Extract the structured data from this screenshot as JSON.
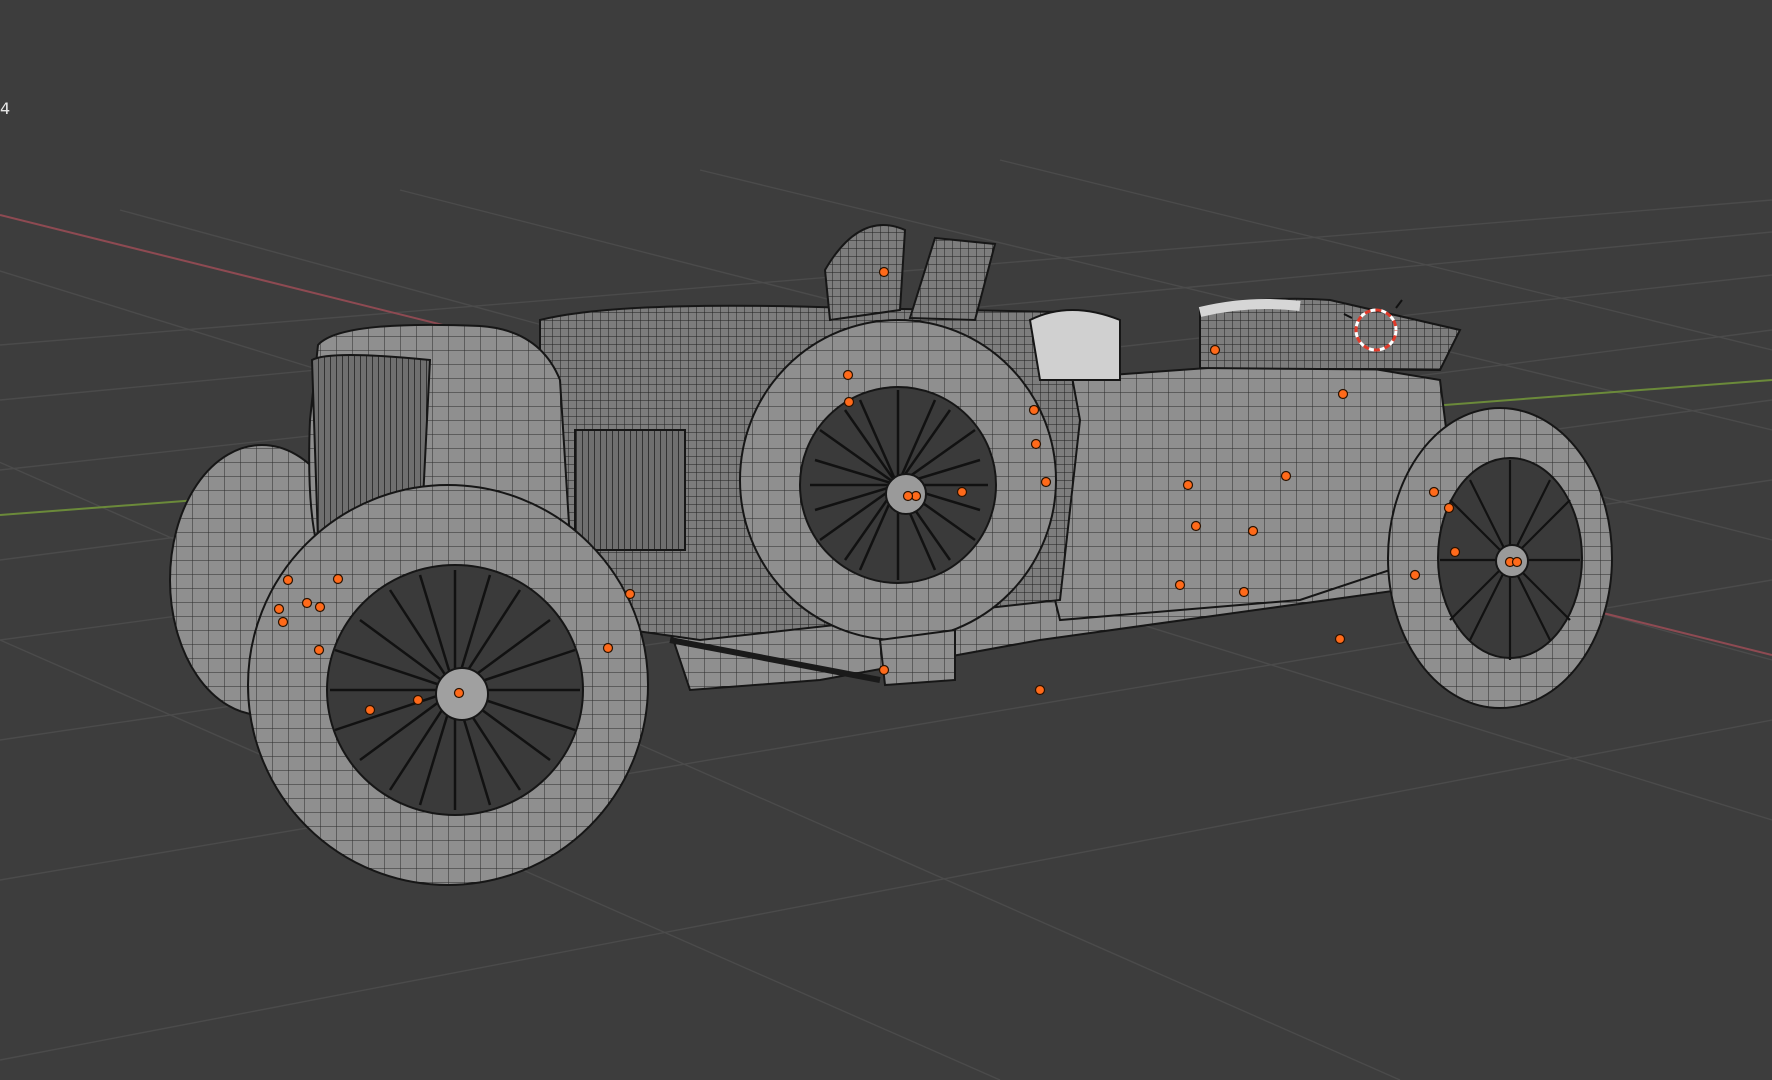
{
  "viewport": {
    "overlay_text": "4",
    "background_color": "#3d3d3d",
    "grid_color": "#4c4c4c",
    "x_axis_color": "#8e4a52",
    "y_axis_color": "#6b8a3a",
    "object_point_color": "#ff6a1a",
    "cursor_icon": "3d-cursor-icon",
    "model": "vintage-race-car-wireframe"
  }
}
